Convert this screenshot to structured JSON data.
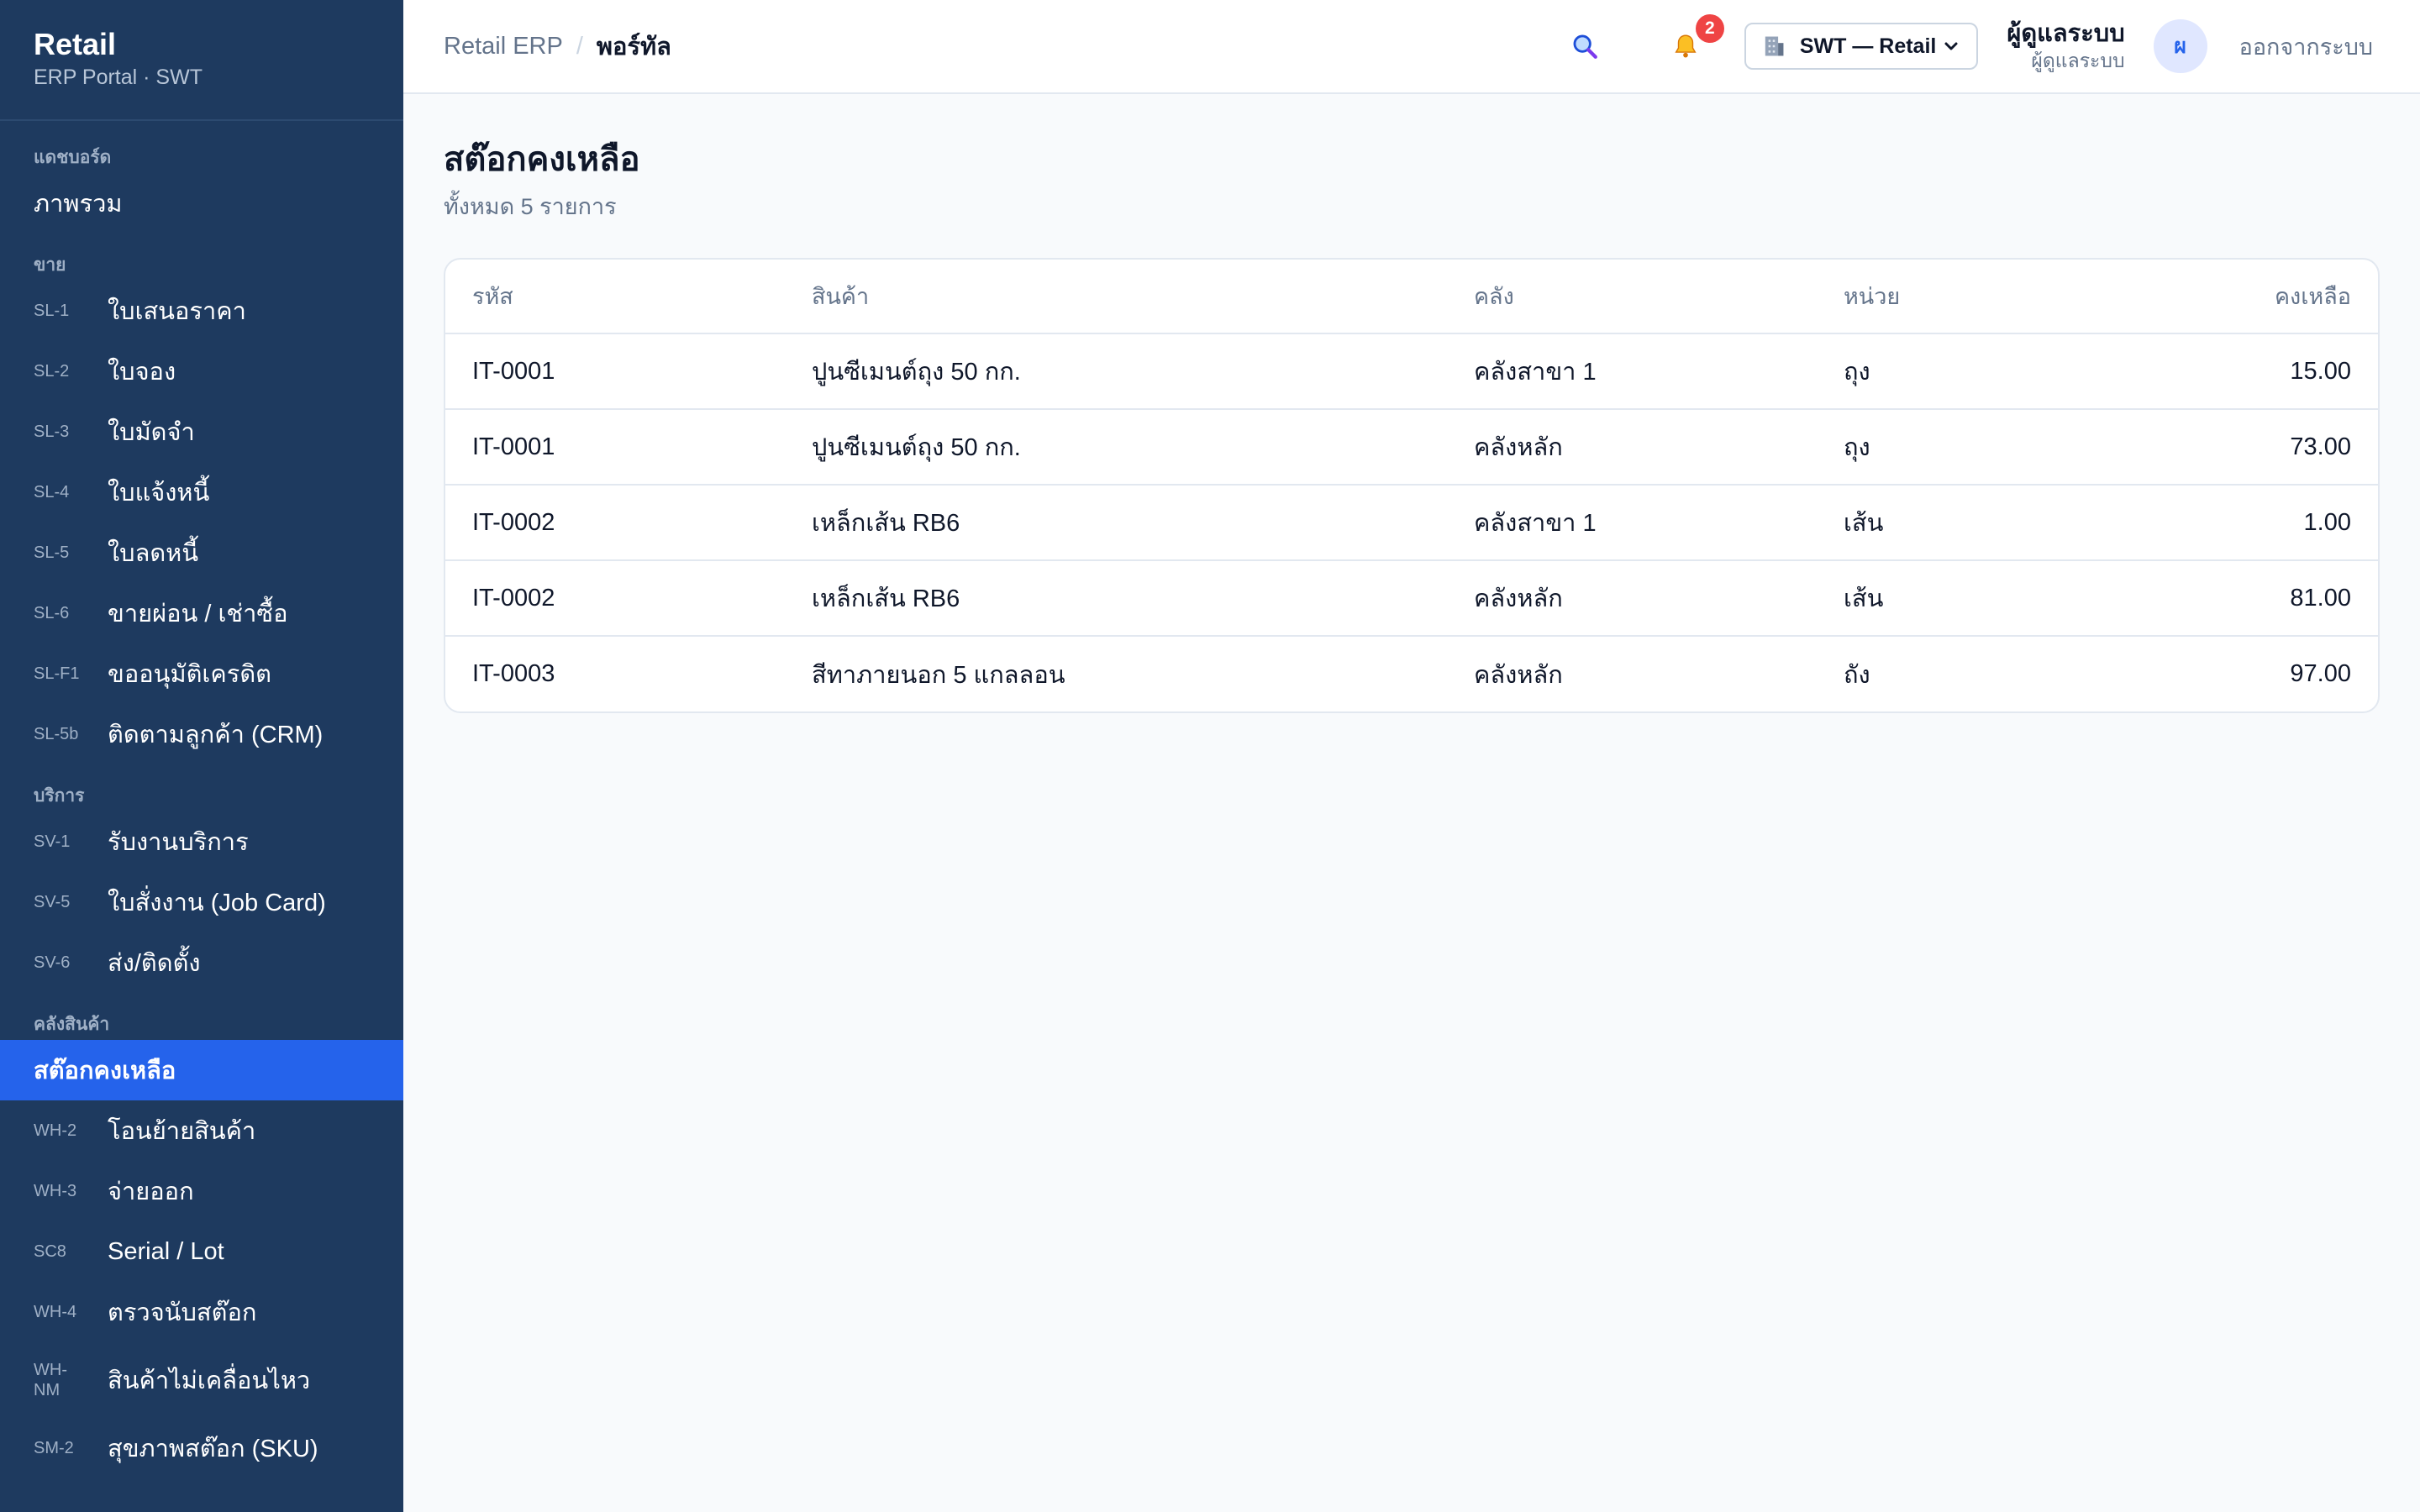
{
  "app": {
    "title": "Retail",
    "subtitle": "ERP Portal · SWT"
  },
  "sidebar": {
    "sections": [
      {
        "label": "แดชบอร์ด",
        "items": [
          {
            "code": "",
            "label": "ภาพรวม"
          }
        ]
      },
      {
        "label": "ขาย",
        "items": [
          {
            "code": "SL-1",
            "label": "ใบเสนอราคา"
          },
          {
            "code": "SL-2",
            "label": "ใบจอง"
          },
          {
            "code": "SL-3",
            "label": "ใบมัดจำ"
          },
          {
            "code": "SL-4",
            "label": "ใบแจ้งหนี้"
          },
          {
            "code": "SL-5",
            "label": "ใบลดหนี้"
          },
          {
            "code": "SL-6",
            "label": "ขายผ่อน / เช่าซื้อ"
          },
          {
            "code": "SL-F1",
            "label": "ขออนุมัติเครดิต"
          },
          {
            "code": "SL-5b",
            "label": "ติดตามลูกค้า (CRM)"
          }
        ]
      },
      {
        "label": "บริการ",
        "items": [
          {
            "code": "SV-1",
            "label": "รับงานบริการ"
          },
          {
            "code": "SV-5",
            "label": "ใบสั่งงาน (Job Card)"
          },
          {
            "code": "SV-6",
            "label": "ส่ง/ติดตั้ง"
          }
        ]
      },
      {
        "label": "คลังสินค้า",
        "items": [
          {
            "code": "",
            "label": "สต๊อกคงเหลือ",
            "active": true
          },
          {
            "code": "WH-2",
            "label": "โอนย้ายสินค้า"
          },
          {
            "code": "WH-3",
            "label": "จ่ายออก"
          },
          {
            "code": "SC8",
            "label": "Serial / Lot"
          },
          {
            "code": "WH-4",
            "label": "ตรวจนับสต๊อก"
          },
          {
            "code": "WH-\nNM",
            "label": "สินค้าไม่เคลื่อนไหว"
          },
          {
            "code": "SM-2",
            "label": "สุขภาพสต๊อก (SKU)"
          }
        ]
      }
    ]
  },
  "header": {
    "breadcrumb": [
      "Retail ERP",
      "พอร์ทัล"
    ],
    "breadcrumb_sep": "/",
    "notifications_count": "2",
    "org_select": "SWT — Retail",
    "user_name": "ผู้ดูแลระบบ",
    "user_role": "ผู้ดูแลระบบ",
    "avatar_initial": "ผ",
    "logout_label": "ออกจากระบบ"
  },
  "page": {
    "title": "สต๊อกคงเหลือ",
    "subtitle": "ทั้งหมด 5 รายการ"
  },
  "table": {
    "columns": [
      "รหัส",
      "สินค้า",
      "คลัง",
      "หน่วย",
      "คงเหลือ"
    ],
    "rows": [
      [
        "IT-0001",
        "ปูนซีเมนต์ถุง 50 กก.",
        "คลังสาขา 1",
        "ถุง",
        "15.00"
      ],
      [
        "IT-0001",
        "ปูนซีเมนต์ถุง 50 กก.",
        "คลังหลัก",
        "ถุง",
        "73.00"
      ],
      [
        "IT-0002",
        "เหล็กเส้น RB6",
        "คลังสาขา 1",
        "เส้น",
        "1.00"
      ],
      [
        "IT-0002",
        "เหล็กเส้น RB6",
        "คลังหลัก",
        "เส้น",
        "81.00"
      ],
      [
        "IT-0003",
        "สีทาภายนอก 5 แกลลอน",
        "คลังหลัก",
        "ถัง",
        "97.00"
      ]
    ]
  },
  "colors": {
    "sidebar": "#1e3a5f",
    "accent": "#2563eb",
    "badge": "#ef4444"
  },
  "icons": {
    "search": "search-icon",
    "bell": "bell-icon",
    "building": "building-icon",
    "chevron": "chevron-down-icon"
  }
}
